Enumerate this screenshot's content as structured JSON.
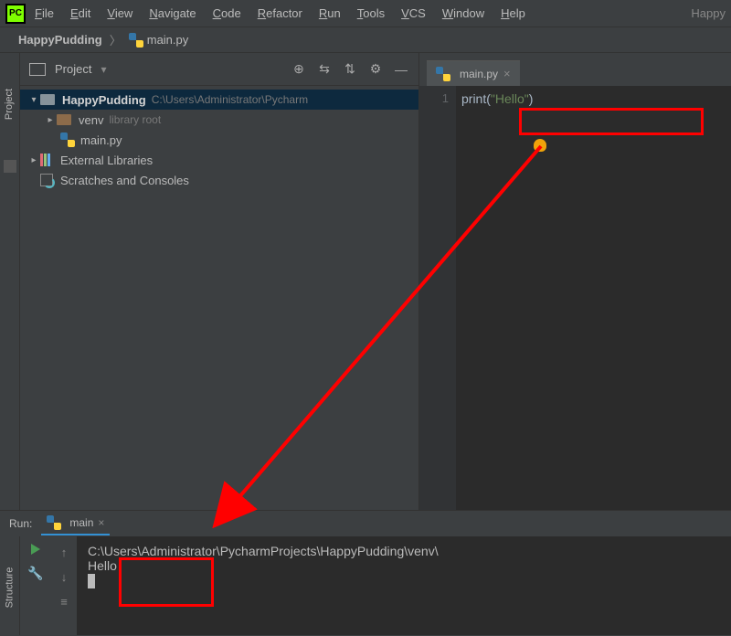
{
  "menu": {
    "file": "File",
    "edit": "Edit",
    "view": "View",
    "navigate": "Navigate",
    "code": "Code",
    "refactor": "Refactor",
    "run": "Run",
    "tools": "Tools",
    "vcs": "VCS",
    "window": "Window",
    "help": "Help"
  },
  "title_right": "Happy",
  "breadcrumb": {
    "project": "HappyPudding",
    "file": "main.py"
  },
  "project_header": {
    "label": "Project"
  },
  "tree": {
    "root": {
      "name": "HappyPudding",
      "path": "C:\\Users\\Administrator\\Pycharm"
    },
    "venv": {
      "name": "venv",
      "hint": "library root"
    },
    "mainpy": "main.py",
    "extlib": "External Libraries",
    "scratch": "Scratches and Consoles"
  },
  "editor": {
    "tab": "main.py",
    "line_no": "1",
    "code_fn": "print",
    "code_str": "\"Hello\""
  },
  "run": {
    "label": "Run:",
    "tab": "main",
    "command": "C:\\Users\\Administrator\\PycharmProjects\\HappyPudding\\venv\\",
    "output": "Hello"
  },
  "sidebar": {
    "project": "Project",
    "structure": "Structure"
  }
}
